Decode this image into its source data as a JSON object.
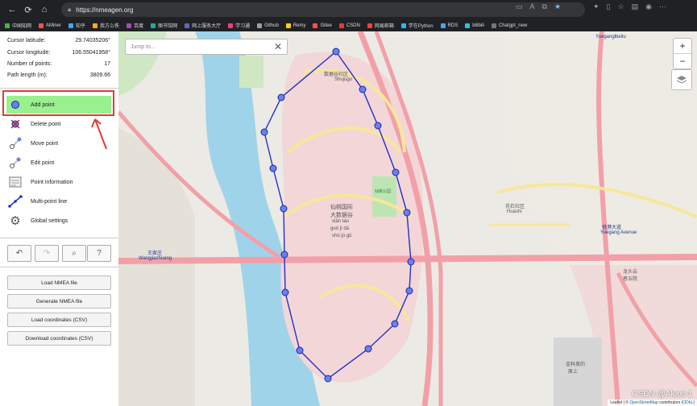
{
  "browser": {
    "url": "https://nmeagen.org",
    "bookmarks": [
      "中国知网",
      "AMiner",
      "知乎",
      "我方么佚",
      "百度",
      "图书馆网",
      "网上服务大厅",
      "学习通",
      "Github",
      "Remy",
      "Gitee",
      "CSDN",
      "网易邮箱",
      "学在Python",
      "RDS",
      "bilibili",
      "Chatgpt_new"
    ]
  },
  "stats": {
    "lat_label": "Cursor latitude:",
    "lat_value": "29.74035206°",
    "lon_label": "Cursor longitude:",
    "lon_value": "106.55041958°",
    "points_label": "Number of points:",
    "points_value": "17",
    "length_label": "Path length (m):",
    "length_value": "3809.66"
  },
  "tools": {
    "add": "Add point",
    "delete": "Delete point",
    "move": "Move point",
    "edit": "Edit point",
    "info": "Point information",
    "multi": "Multi-point line",
    "settings": "Global settings"
  },
  "actions": {
    "load_nmea": "Load NMEA file",
    "gen_nmea": "Generate NMEA file",
    "load_csv": "Load coordinates (CSV)",
    "download_csv": "Download coordinates (CSV)"
  },
  "map": {
    "jump_placeholder": "Jump to...",
    "zoom_in": "+",
    "zoom_out": "−",
    "attribution_prefix": "Leaflet | © ",
    "attribution_osm": "OpenStreetMap",
    "attribution_suffix": " contributors (",
    "attribution_odbl": "ODbL",
    "attribution_end": ")",
    "watermark": "CSDN @Akaxi-1",
    "labels": {
      "shujugu": "数据谷社区",
      "shujugu_py": "Shujugu",
      "xiantao1": "仙桃国际",
      "xiantao2": "大数据谷",
      "xiantao_py1": "xiān táo",
      "xiantao_py2": "guó jì dà",
      "xiantao_py3": "shù jù gǔ",
      "park": "仙桃公园",
      "huashi": "花石社区",
      "huashi_py": "Huashi",
      "wangjia": "王家庄",
      "wangjia_py": "Wangjiazhuang",
      "yuegang": "悦港大道",
      "yuegang_py": "Yuegang Avenue",
      "yuegangbeilu": "Yueganglbeilu",
      "longtou1": "龙头云",
      "longtou2": "巷五院",
      "jinke1": "金科美的",
      "jinke2": "原上"
    }
  },
  "colors": {
    "accent_green": "#98f08f",
    "route": "#2230c8",
    "highlight": "#e53935"
  }
}
